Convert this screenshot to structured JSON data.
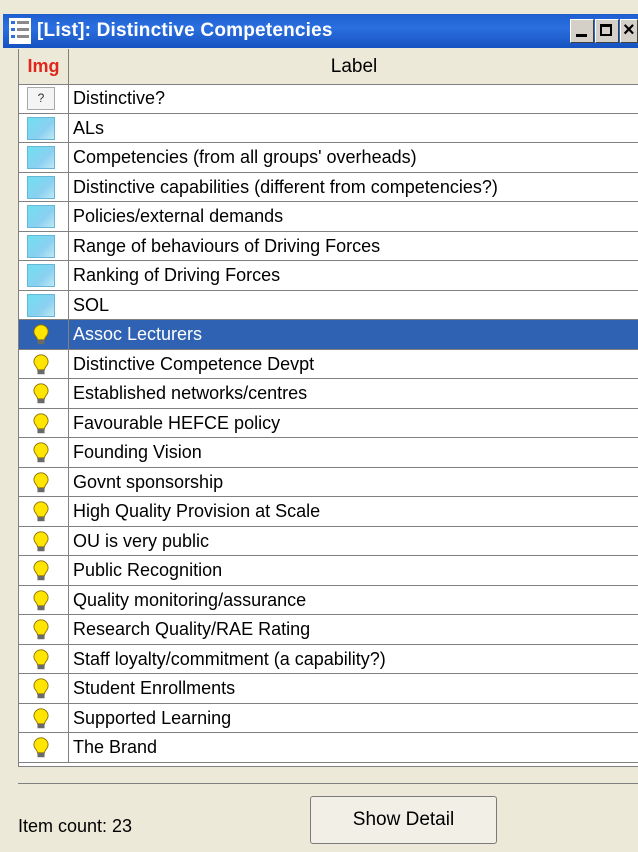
{
  "window": {
    "title": "[List]: Distinctive Competencies",
    "close_glyph": "×"
  },
  "table": {
    "col_img": "Img",
    "col_label": "Label",
    "rows": [
      {
        "icon": "question-note-icon",
        "q": "?",
        "label": "Distinctive?"
      },
      {
        "icon": "note-icon",
        "label": "ALs"
      },
      {
        "icon": "note-icon",
        "label": "Competencies (from all groups' overheads)"
      },
      {
        "icon": "note-icon",
        "label": "Distinctive capabilities (different from competencies?)"
      },
      {
        "icon": "note-icon",
        "label": "Policies/external demands"
      },
      {
        "icon": "note-icon",
        "label": "Range of behaviours of Driving Forces"
      },
      {
        "icon": "note-icon",
        "label": "Ranking of Driving Forces"
      },
      {
        "icon": "note-icon",
        "label": "SOL"
      },
      {
        "icon": "lightbulb-icon",
        "label": "Assoc Lecturers",
        "selected": true
      },
      {
        "icon": "lightbulb-icon",
        "label": "Distinctive Competence Devpt"
      },
      {
        "icon": "lightbulb-icon",
        "label": "Established networks/centres"
      },
      {
        "icon": "lightbulb-icon",
        "label": "Favourable HEFCE policy"
      },
      {
        "icon": "lightbulb-icon",
        "label": "Founding Vision"
      },
      {
        "icon": "lightbulb-icon",
        "label": "Govnt sponsorship"
      },
      {
        "icon": "lightbulb-icon",
        "label": "High Quality Provision at Scale"
      },
      {
        "icon": "lightbulb-icon",
        "label": "OU is very public"
      },
      {
        "icon": "lightbulb-icon",
        "label": "Public Recognition"
      },
      {
        "icon": "lightbulb-icon",
        "label": "Quality monitoring/assurance"
      },
      {
        "icon": "lightbulb-icon",
        "label": "Research Quality/RAE Rating"
      },
      {
        "icon": "lightbulb-icon",
        "label": "Staff loyalty/commitment (a capability?)"
      },
      {
        "icon": "lightbulb-icon",
        "label": "Student Enrollments"
      },
      {
        "icon": "lightbulb-icon",
        "label": "Supported Learning"
      },
      {
        "icon": "lightbulb-icon",
        "label": "The Brand"
      }
    ]
  },
  "footer": {
    "item_count_label": "Item count: 23",
    "show_detail_label": "Show Detail"
  },
  "colors": {
    "titlebar": "#2b6fe0",
    "selection": "#2f62b3",
    "header_img_text": "#e0271c",
    "bulb": "#ffe500"
  }
}
